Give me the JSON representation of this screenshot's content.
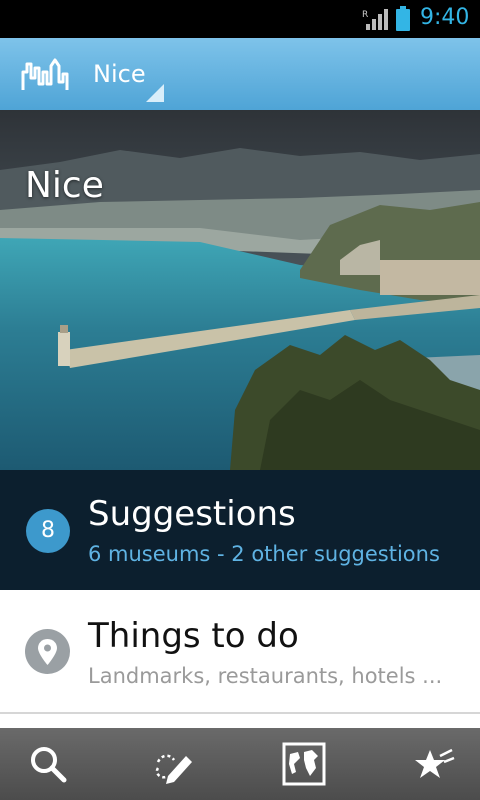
{
  "status_bar": {
    "time": "9:40",
    "icons": [
      "signal-roaming-icon",
      "battery-icon"
    ]
  },
  "action_bar": {
    "title": "Nice",
    "logo": "city-skyline-logo"
  },
  "hero": {
    "title": "Nice"
  },
  "suggestions": {
    "count": "8",
    "title": "Suggestions",
    "subtitle": "6 museums - 2 other suggestions"
  },
  "things_to_do": {
    "title": "Things to do",
    "subtitle": "Landmarks, restaurants, hotels ..."
  },
  "bottom_bar": {
    "tabs": [
      "search-icon",
      "draw-route-icon",
      "world-map-icon",
      "favorites-icon"
    ]
  },
  "colors": {
    "accent": "#33b5e5",
    "action_bar": "#5faedc",
    "suggestions_bg": "#0c1f2e",
    "badge": "#3d99cc"
  }
}
